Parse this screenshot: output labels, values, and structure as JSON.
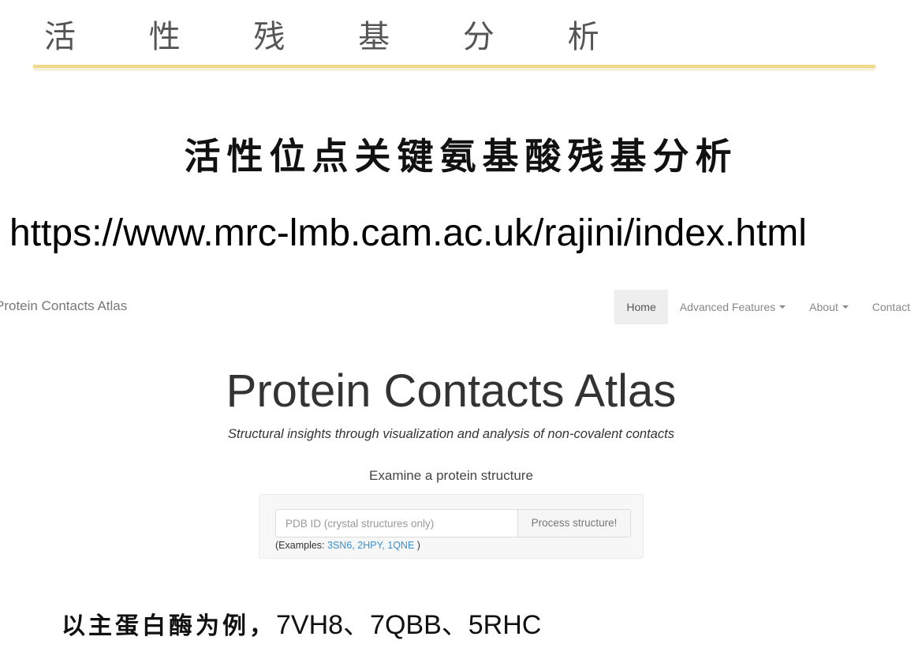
{
  "slide": {
    "title": "活 性 残 基 分 析",
    "subtitle": "活性位点关键氨基酸残基分析",
    "url": "https://www.mrc-lmb.cam.ac.uk/rajini/index.html",
    "footer_cn": "以主蛋白酶为例，",
    "footer_codes": "7VH8、7QBB、5RHC",
    "accent_color": "#efd98a"
  },
  "site": {
    "brand": "Protein Contacts Atlas",
    "nav": {
      "home": "Home",
      "advanced": "Advanced Features",
      "about": "About",
      "contact": "Contact"
    },
    "hero_title": "Protein Contacts Atlas",
    "hero_subtitle": "Structural insights through visualization and analysis of non-covalent contacts",
    "examine_label": "Examine a protein structure",
    "input_placeholder": "PDB ID (crystal structures only)",
    "process_button": "Process structure!",
    "examples_prefix": "(Examples:",
    "examples": [
      "3SN6,",
      "2HPY,",
      "1QNE"
    ],
    "examples_suffix": ")",
    "link_color": "#3a8fd0"
  }
}
